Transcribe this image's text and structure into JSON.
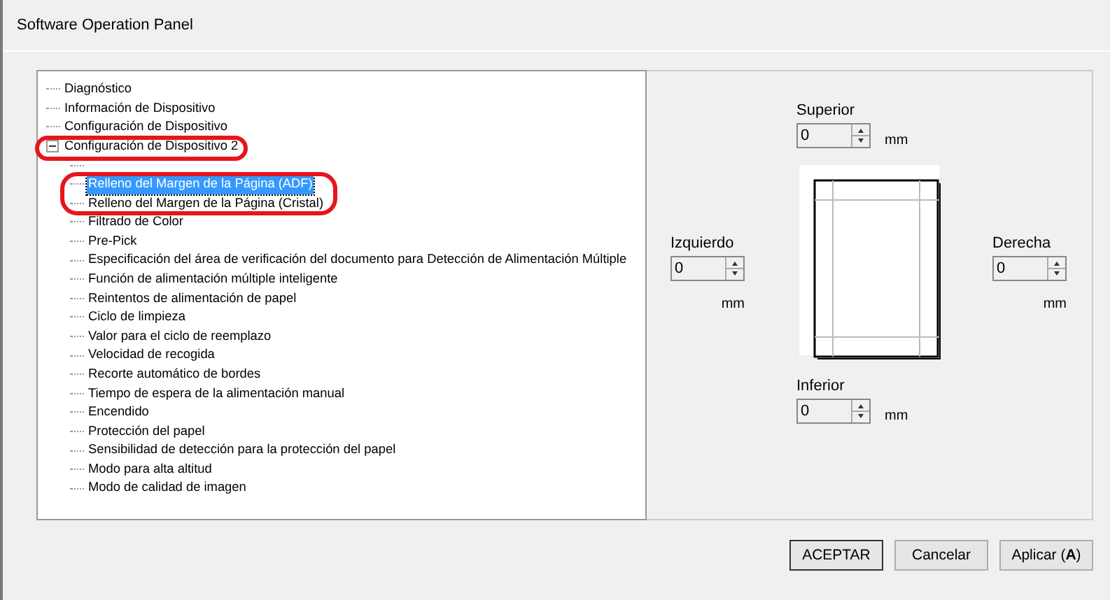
{
  "window": {
    "title": "Software Operation Panel"
  },
  "tree": [
    {
      "label": "Diagnóstico",
      "circled": false,
      "selected": false
    },
    {
      "label": "Información de Dispositivo",
      "circled": false,
      "selected": false
    },
    {
      "label": "Configuración de Dispositivo",
      "circled": false,
      "selected": false
    },
    {
      "label": "Configuración de Dispositivo 2",
      "circled": true,
      "selected": false,
      "expanded": true,
      "children": [
        {
          "kind": "covered"
        },
        {
          "label": "Relleno del Margen de la Página (ADF)",
          "circled": true,
          "selected": true
        },
        {
          "label": "Relleno del Margen de la Página (Cristal)",
          "circled": true,
          "selected": false
        },
        {
          "label": "Filtrado de Color",
          "circled": false,
          "selected": false
        },
        {
          "label": "Pre-Pick",
          "circled": false,
          "selected": false
        },
        {
          "label": "Especificación del área de verificación del documento para Detección de Alimentación Múltiple",
          "circled": false,
          "selected": false
        },
        {
          "label": "Función de alimentación múltiple inteligente",
          "circled": false,
          "selected": false
        },
        {
          "label": "Reintentos de alimentación de papel",
          "circled": false,
          "selected": false
        },
        {
          "label": "Ciclo de limpieza",
          "circled": false,
          "selected": false
        },
        {
          "label": "Valor para el ciclo de reemplazo",
          "circled": false,
          "selected": false
        },
        {
          "label": "Velocidad de recogida",
          "circled": false,
          "selected": false
        },
        {
          "label": "Recorte automático de bordes",
          "circled": false,
          "selected": false
        },
        {
          "label": "Tiempo de espera de la alimentación manual",
          "circled": false,
          "selected": false
        },
        {
          "label": "Encendido",
          "circled": false,
          "selected": false
        },
        {
          "label": "Protección del papel",
          "circled": false,
          "selected": false
        },
        {
          "label": "Sensibilidad de detección para la protección del papel",
          "circled": false,
          "selected": false
        },
        {
          "label": "Modo para alta altitud",
          "circled": false,
          "selected": false
        },
        {
          "label": "Modo de calidad de imagen",
          "circled": false,
          "selected": false
        }
      ]
    }
  ],
  "margins": {
    "top": {
      "label": "Superior",
      "value": "0",
      "unit": "mm"
    },
    "left": {
      "label": "Izquierdo",
      "value": "0",
      "unit": "mm"
    },
    "right": {
      "label": "Derecha",
      "value": "0",
      "unit": "mm"
    },
    "bottom": {
      "label": "Inferior",
      "value": "0",
      "unit": "mm"
    }
  },
  "buttons": [
    "ACEPTAR",
    "Cancelar",
    "Aplicar (**A**)"
  ]
}
